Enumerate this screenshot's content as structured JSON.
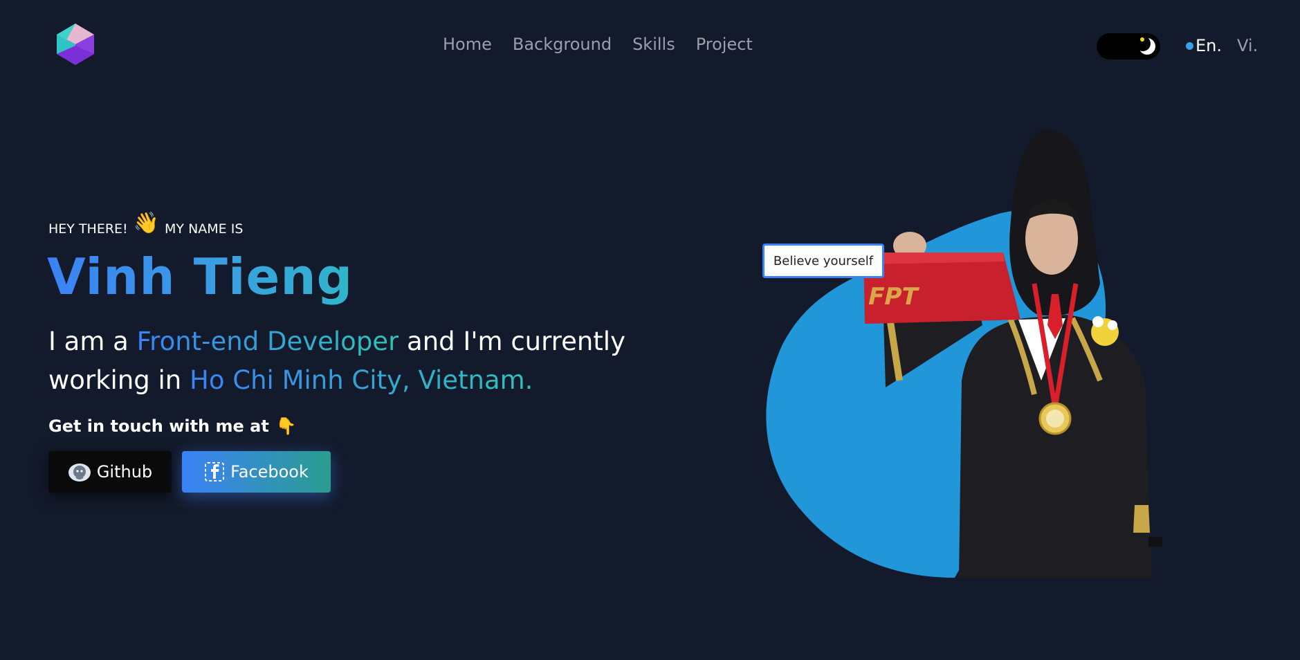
{
  "nav": {
    "items": [
      {
        "label": "Home"
      },
      {
        "label": "Background"
      },
      {
        "label": "Skills"
      },
      {
        "label": "Project"
      }
    ]
  },
  "lang": {
    "en": "En.",
    "vi": "Vi."
  },
  "hero": {
    "greeting_before": "HEY THERE!",
    "greeting_emoji": "👋",
    "greeting_after": "MY NAME IS",
    "name": "Vinh Tieng",
    "intro_1": "I am a ",
    "intro_role": "Front-end Developer",
    "intro_2": " and I'm currently working in ",
    "intro_location": "Ho Chi Minh City, Vietnam.",
    "contact": "Get in touch with me at",
    "contact_emoji": "👇",
    "quote": "Believe yourself"
  },
  "buttons": {
    "github": "Github",
    "facebook": "Facebook"
  },
  "colors": {
    "background": "#131a2b",
    "accent_blue": "#3b82f6",
    "accent_teal": "#2ec4b6",
    "blob": "#2196d9"
  },
  "icons": {
    "logo": "cube-logo-icon",
    "theme": "moon-icon",
    "github": "github-octocat-icon",
    "facebook": "facebook-icon"
  }
}
